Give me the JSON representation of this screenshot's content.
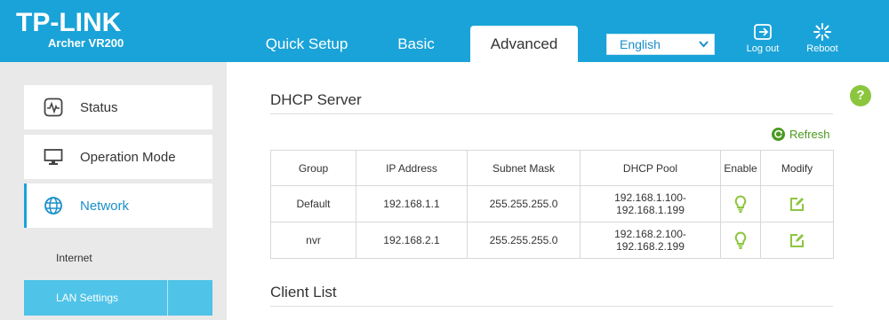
{
  "header": {
    "brand": "TP-LINK",
    "model": "Archer VR200",
    "tabs": [
      {
        "label": "Quick Setup"
      },
      {
        "label": "Basic"
      },
      {
        "label": "Advanced"
      }
    ],
    "language": "English",
    "logout_label": "Log out",
    "reboot_label": "Reboot"
  },
  "sidebar": {
    "items": [
      {
        "label": "Status",
        "icon": "status-icon"
      },
      {
        "label": "Operation Mode",
        "icon": "monitor-icon"
      },
      {
        "label": "Network",
        "icon": "globe-icon"
      }
    ],
    "subitems": [
      {
        "label": "Internet"
      },
      {
        "label": "LAN Settings"
      }
    ]
  },
  "main": {
    "dhcp_title": "DHCP Server",
    "refresh_label": "Refresh",
    "help_label": "?",
    "client_title": "Client List",
    "table": {
      "columns": [
        "Group",
        "IP Address",
        "Subnet Mask",
        "DHCP Pool",
        "Enable",
        "Modify"
      ],
      "rows": [
        {
          "group": "Default",
          "ip": "192.168.1.1",
          "mask": "255.255.255.0",
          "pool_start": "192.168.1.100-",
          "pool_end": "192.168.1.199"
        },
        {
          "group": "nvr",
          "ip": "192.168.2.1",
          "mask": "255.255.255.0",
          "pool_start": "192.168.2.100-",
          "pool_end": "192.168.2.199"
        }
      ]
    }
  },
  "colors": {
    "header_blue": "#1aa3d8",
    "active_sub": "#4fc3e8",
    "green": "#8cc63e",
    "link_blue": "#1a8fc9"
  }
}
